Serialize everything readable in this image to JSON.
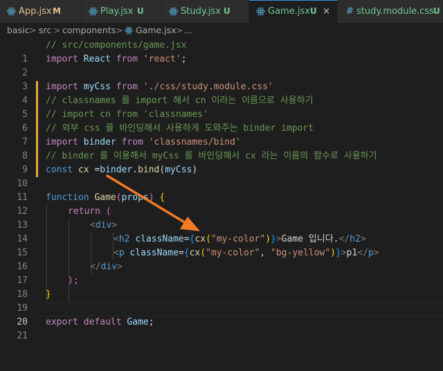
{
  "tabs": [
    {
      "icon": "js-icon",
      "name": "App.jsx",
      "badge": "M",
      "active": false
    },
    {
      "icon": "react-icon",
      "name": "Play.jsx",
      "badge": "U",
      "active": false
    },
    {
      "icon": "react-icon",
      "name": "Study.jsx",
      "badge": "U",
      "active": false
    },
    {
      "icon": "react-icon",
      "name": "Game.jsx",
      "badge": "U",
      "active": true,
      "close": "×"
    },
    {
      "icon": "css-icon",
      "name": "study.module.css",
      "badge": "U",
      "active": false
    }
  ],
  "breadcrumb": {
    "parts": [
      "basic",
      "src",
      "components",
      "Game.jsx",
      "..."
    ],
    "sep": ">"
  },
  "line_numbers": [
    "1",
    "2",
    "3",
    "4",
    "5",
    "6",
    "7",
    "8",
    "9",
    "10",
    "11",
    "12",
    "13",
    "14",
    "15",
    "16",
    "17",
    "18",
    "19",
    "20",
    "21"
  ],
  "code": {
    "l1": "// src/components/game.jsx",
    "l2": [
      "import",
      " React ",
      "from",
      " ",
      "'react'",
      ";"
    ],
    "l4": [
      "import",
      " myCss ",
      "from",
      " ",
      "'./css/study.module.css'"
    ],
    "l5": "// classnames 를 import 해서 cn 이라는 이름으로 사용하기",
    "l6": "// import cn from 'classnames'",
    "l7": "// 외부 css 를 바인딩해서 사용하게 도와주는 binder import",
    "l8": [
      "import",
      " binder ",
      "from",
      " ",
      "'classnames/bind'"
    ],
    "l9": "// binder 를 이용해서 myCss 를 바인딩해서 cx 라는 이름의 함수로 사용하기",
    "l10": [
      "const",
      " ",
      "cx",
      " =",
      "binder",
      ".",
      "bind",
      "(",
      "myCss",
      ")"
    ],
    "l12": [
      "function",
      " ",
      "Game",
      "(",
      "props",
      ")",
      " ",
      "{"
    ],
    "l13": [
      "return",
      " ",
      "("
    ],
    "l14": [
      "<",
      "div",
      ">"
    ],
    "l15": [
      "<",
      "h2",
      " ",
      "className",
      "=",
      "{",
      "cx",
      "(",
      "\"my-color\"",
      ")",
      "}",
      ">",
      "Game 입니다.",
      "</",
      "h2",
      ">"
    ],
    "l16": [
      "<",
      "p",
      " ",
      "className",
      "=",
      "{",
      "cx",
      "(",
      "\"my-color\"",
      ", ",
      "\"bg-yellow\"",
      ")",
      "}",
      ">",
      "p1",
      "</",
      "p",
      ">"
    ],
    "l17": [
      "</",
      "div",
      ">"
    ],
    "l18": [
      ");"
    ],
    "l19": [
      "}"
    ],
    "l21": [
      "export",
      " ",
      "default",
      " ",
      "Game",
      ";"
    ]
  },
  "colors": {
    "editor_bg": "#1e1e1e",
    "tab_bg": "#2d2d2d",
    "active_tab_border": "#3c8fd8",
    "modified_gutter": "#e7a93d",
    "arrow": "#f07a27",
    "untracked_text": "#73c991",
    "modified_text": "#e2c08d"
  },
  "annotation": {
    "type": "arrow-icon"
  }
}
